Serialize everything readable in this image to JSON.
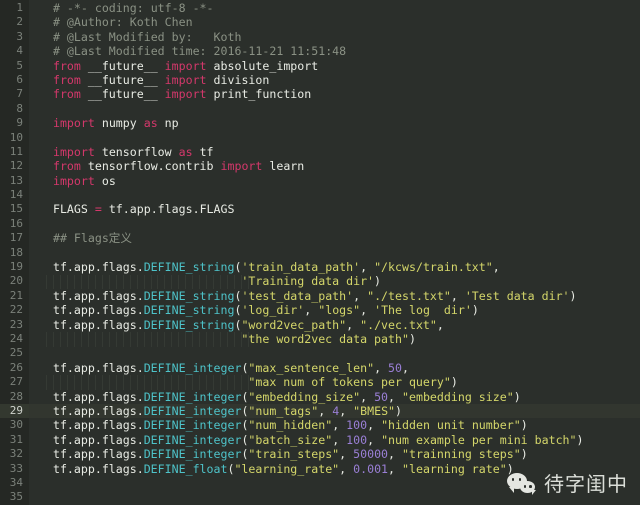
{
  "editor": {
    "theme": "dark-monokai-like",
    "colors": {
      "background": "#2b2f2b",
      "gutter_background": "#252824",
      "comment": "#8a9184",
      "keyword": "#d4386b",
      "function": "#4ec3c9",
      "string": "#d4d66a",
      "number": "#9a7fd6",
      "text": "#e3e6e0",
      "current_line": "#32362f"
    },
    "current_line_number": 29,
    "total_lines": 35,
    "line_numbers": [
      1,
      2,
      3,
      4,
      5,
      6,
      7,
      8,
      9,
      10,
      11,
      12,
      13,
      14,
      15,
      16,
      17,
      18,
      19,
      20,
      21,
      22,
      23,
      24,
      25,
      26,
      27,
      28,
      29,
      30,
      31,
      32,
      33,
      34,
      35
    ],
    "lines": [
      {
        "n": 1,
        "tokens": [
          {
            "t": "  ",
            "c": "op"
          },
          {
            "t": "# -*- coding: utf-8 -*-",
            "c": "c"
          }
        ]
      },
      {
        "n": 2,
        "tokens": [
          {
            "t": "  ",
            "c": "op"
          },
          {
            "t": "# @Author: Koth Chen",
            "c": "c"
          }
        ]
      },
      {
        "n": 3,
        "tokens": [
          {
            "t": "  ",
            "c": "op"
          },
          {
            "t": "# @Last Modified by:   Koth",
            "c": "c"
          }
        ]
      },
      {
        "n": 4,
        "tokens": [
          {
            "t": "  ",
            "c": "op"
          },
          {
            "t": "# @Last Modified time: 2016-11-21 11:51:48",
            "c": "c"
          }
        ]
      },
      {
        "n": 5,
        "tokens": [
          {
            "t": "  ",
            "c": "op"
          },
          {
            "t": "from",
            "c": "k"
          },
          {
            "t": " __future__ ",
            "c": "n"
          },
          {
            "t": "import",
            "c": "k"
          },
          {
            "t": " absolute_import",
            "c": "n"
          }
        ]
      },
      {
        "n": 6,
        "tokens": [
          {
            "t": "  ",
            "c": "op"
          },
          {
            "t": "from",
            "c": "k"
          },
          {
            "t": " __future__ ",
            "c": "n"
          },
          {
            "t": "import",
            "c": "k"
          },
          {
            "t": " division",
            "c": "n"
          }
        ]
      },
      {
        "n": 7,
        "tokens": [
          {
            "t": "  ",
            "c": "op"
          },
          {
            "t": "from",
            "c": "k"
          },
          {
            "t": " __future__ ",
            "c": "n"
          },
          {
            "t": "import",
            "c": "k"
          },
          {
            "t": " print_function",
            "c": "n"
          }
        ]
      },
      {
        "n": 8,
        "tokens": []
      },
      {
        "n": 9,
        "tokens": [
          {
            "t": "  ",
            "c": "op"
          },
          {
            "t": "import",
            "c": "k"
          },
          {
            "t": " numpy ",
            "c": "n"
          },
          {
            "t": "as",
            "c": "k"
          },
          {
            "t": " np",
            "c": "n"
          }
        ]
      },
      {
        "n": 10,
        "tokens": []
      },
      {
        "n": 11,
        "tokens": [
          {
            "t": "  ",
            "c": "op"
          },
          {
            "t": "import",
            "c": "k"
          },
          {
            "t": " tensorflow ",
            "c": "n"
          },
          {
            "t": "as",
            "c": "k"
          },
          {
            "t": " tf",
            "c": "n"
          }
        ]
      },
      {
        "n": 12,
        "tokens": [
          {
            "t": "  ",
            "c": "op"
          },
          {
            "t": "from",
            "c": "k"
          },
          {
            "t": " tensorflow.contrib ",
            "c": "n"
          },
          {
            "t": "import",
            "c": "k"
          },
          {
            "t": " learn",
            "c": "n"
          }
        ]
      },
      {
        "n": 13,
        "tokens": [
          {
            "t": "  ",
            "c": "op"
          },
          {
            "t": "import",
            "c": "k"
          },
          {
            "t": " os",
            "c": "n"
          }
        ]
      },
      {
        "n": 14,
        "tokens": []
      },
      {
        "n": 15,
        "tokens": [
          {
            "t": "  ",
            "c": "op"
          },
          {
            "t": "FLAGS ",
            "c": "n"
          },
          {
            "t": "=",
            "c": "k"
          },
          {
            "t": " tf.app.flags.FLAGS",
            "c": "n"
          }
        ]
      },
      {
        "n": 16,
        "tokens": []
      },
      {
        "n": 17,
        "tokens": [
          {
            "t": "  ",
            "c": "op"
          },
          {
            "t": "## Flags定义",
            "c": "c"
          }
        ]
      },
      {
        "n": 18,
        "tokens": []
      },
      {
        "n": 19,
        "tokens": [
          {
            "t": "  tf.app.flags.",
            "c": "n"
          },
          {
            "t": "DEFINE_string",
            "c": "f"
          },
          {
            "t": "(",
            "c": "op"
          },
          {
            "t": "'train_data_path'",
            "c": "s"
          },
          {
            "t": ", ",
            "c": "op"
          },
          {
            "t": "\"/kcws/train.txt\"",
            "c": "s"
          },
          {
            "t": ",",
            "c": "op"
          }
        ]
      },
      {
        "n": 20,
        "tokens": [
          {
            "t": "                             ",
            "c": "op"
          },
          {
            "t": "'Training data dir'",
            "c": "s"
          },
          {
            "t": ")",
            "c": "op"
          }
        ]
      },
      {
        "n": 21,
        "tokens": [
          {
            "t": "  tf.app.flags.",
            "c": "n"
          },
          {
            "t": "DEFINE_string",
            "c": "f"
          },
          {
            "t": "(",
            "c": "op"
          },
          {
            "t": "'test_data_path'",
            "c": "s"
          },
          {
            "t": ", ",
            "c": "op"
          },
          {
            "t": "\"./test.txt\"",
            "c": "s"
          },
          {
            "t": ", ",
            "c": "op"
          },
          {
            "t": "'Test data dir'",
            "c": "s"
          },
          {
            "t": ")",
            "c": "op"
          }
        ]
      },
      {
        "n": 22,
        "tokens": [
          {
            "t": "  tf.app.flags.",
            "c": "n"
          },
          {
            "t": "DEFINE_string",
            "c": "f"
          },
          {
            "t": "(",
            "c": "op"
          },
          {
            "t": "'log_dir'",
            "c": "s"
          },
          {
            "t": ", ",
            "c": "op"
          },
          {
            "t": "\"logs\"",
            "c": "s"
          },
          {
            "t": ", ",
            "c": "op"
          },
          {
            "t": "'The log  dir'",
            "c": "s"
          },
          {
            "t": ")",
            "c": "op"
          }
        ]
      },
      {
        "n": 23,
        "tokens": [
          {
            "t": "  tf.app.flags.",
            "c": "n"
          },
          {
            "t": "DEFINE_string",
            "c": "f"
          },
          {
            "t": "(",
            "c": "op"
          },
          {
            "t": "\"word2vec_path\"",
            "c": "s"
          },
          {
            "t": ", ",
            "c": "op"
          },
          {
            "t": "\"./vec.txt\"",
            "c": "s"
          },
          {
            "t": ",",
            "c": "op"
          }
        ]
      },
      {
        "n": 24,
        "tokens": [
          {
            "t": "                             ",
            "c": "op"
          },
          {
            "t": "\"the word2vec data path\"",
            "c": "s"
          },
          {
            "t": ")",
            "c": "op"
          }
        ]
      },
      {
        "n": 25,
        "tokens": []
      },
      {
        "n": 26,
        "tokens": [
          {
            "t": "  tf.app.flags.",
            "c": "n"
          },
          {
            "t": "DEFINE_integer",
            "c": "f"
          },
          {
            "t": "(",
            "c": "op"
          },
          {
            "t": "\"max_sentence_len\"",
            "c": "s"
          },
          {
            "t": ", ",
            "c": "op"
          },
          {
            "t": "50",
            "c": "num"
          },
          {
            "t": ",",
            "c": "op"
          }
        ]
      },
      {
        "n": 27,
        "tokens": [
          {
            "t": "                              ",
            "c": "op"
          },
          {
            "t": "\"max num of tokens per query\"",
            "c": "s"
          },
          {
            "t": ")",
            "c": "op"
          }
        ]
      },
      {
        "n": 28,
        "tokens": [
          {
            "t": "  tf.app.flags.",
            "c": "n"
          },
          {
            "t": "DEFINE_integer",
            "c": "f"
          },
          {
            "t": "(",
            "c": "op"
          },
          {
            "t": "\"embedding_size\"",
            "c": "s"
          },
          {
            "t": ", ",
            "c": "op"
          },
          {
            "t": "50",
            "c": "num"
          },
          {
            "t": ", ",
            "c": "op"
          },
          {
            "t": "\"embedding size\"",
            "c": "s"
          },
          {
            "t": ")",
            "c": "op"
          }
        ]
      },
      {
        "n": 29,
        "tokens": [
          {
            "t": "  tf.app.flags.",
            "c": "n"
          },
          {
            "t": "DEFINE_integer",
            "c": "f"
          },
          {
            "t": "(",
            "c": "op"
          },
          {
            "t": "\"num_tags\"",
            "c": "s"
          },
          {
            "t": ", ",
            "c": "op"
          },
          {
            "t": "4",
            "c": "num"
          },
          {
            "t": ", ",
            "c": "op"
          },
          {
            "t": "\"BMES\"",
            "c": "s"
          },
          {
            "t": ")",
            "c": "op"
          }
        ]
      },
      {
        "n": 30,
        "tokens": [
          {
            "t": "  tf.app.flags.",
            "c": "n"
          },
          {
            "t": "DEFINE_integer",
            "c": "f"
          },
          {
            "t": "(",
            "c": "op"
          },
          {
            "t": "\"num_hidden\"",
            "c": "s"
          },
          {
            "t": ", ",
            "c": "op"
          },
          {
            "t": "100",
            "c": "num"
          },
          {
            "t": ", ",
            "c": "op"
          },
          {
            "t": "\"hidden unit number\"",
            "c": "s"
          },
          {
            "t": ")",
            "c": "op"
          }
        ]
      },
      {
        "n": 31,
        "tokens": [
          {
            "t": "  tf.app.flags.",
            "c": "n"
          },
          {
            "t": "DEFINE_integer",
            "c": "f"
          },
          {
            "t": "(",
            "c": "op"
          },
          {
            "t": "\"batch_size\"",
            "c": "s"
          },
          {
            "t": ", ",
            "c": "op"
          },
          {
            "t": "100",
            "c": "num"
          },
          {
            "t": ", ",
            "c": "op"
          },
          {
            "t": "\"num example per mini batch\"",
            "c": "s"
          },
          {
            "t": ")",
            "c": "op"
          }
        ]
      },
      {
        "n": 32,
        "tokens": [
          {
            "t": "  tf.app.flags.",
            "c": "n"
          },
          {
            "t": "DEFINE_integer",
            "c": "f"
          },
          {
            "t": "(",
            "c": "op"
          },
          {
            "t": "\"train_steps\"",
            "c": "s"
          },
          {
            "t": ", ",
            "c": "op"
          },
          {
            "t": "50000",
            "c": "num"
          },
          {
            "t": ", ",
            "c": "op"
          },
          {
            "t": "\"trainning steps\"",
            "c": "s"
          },
          {
            "t": ")",
            "c": "op"
          }
        ]
      },
      {
        "n": 33,
        "tokens": [
          {
            "t": "  tf.app.flags.",
            "c": "n"
          },
          {
            "t": "DEFINE_float",
            "c": "f"
          },
          {
            "t": "(",
            "c": "op"
          },
          {
            "t": "\"learning_rate\"",
            "c": "s"
          },
          {
            "t": ", ",
            "c": "op"
          },
          {
            "t": "0.001",
            "c": "num"
          },
          {
            "t": ", ",
            "c": "op"
          },
          {
            "t": "\"learning rate\"",
            "c": "s"
          },
          {
            "t": ")",
            "c": "op"
          }
        ]
      },
      {
        "n": 34,
        "tokens": []
      },
      {
        "n": 35,
        "tokens": []
      }
    ]
  },
  "watermark": {
    "text": "待字闺中",
    "logo": "wechat-icon"
  }
}
